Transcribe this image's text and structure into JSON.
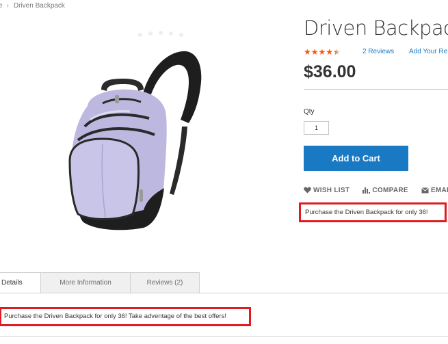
{
  "breadcrumb": {
    "home": "e",
    "current": "Driven Backpack"
  },
  "product": {
    "title": "Driven Backpack",
    "rating": 4.5,
    "rating_max": 5,
    "reviews_link": "2 Reviews",
    "add_review_link": "Add Your Re",
    "price": "$36.00",
    "qty_label": "Qty",
    "qty_value": "1",
    "add_to_cart": "Add to Cart",
    "actions": [
      {
        "label": "WISH LIST",
        "icon": "heart-icon"
      },
      {
        "label": "COMPARE",
        "icon": "compare-icon"
      },
      {
        "label": "EMAI",
        "icon": "envelope-icon"
      }
    ],
    "short_description": "Purchase the Driven Backpack for only 36!"
  },
  "tabs": [
    {
      "label": "Details",
      "active": true
    },
    {
      "label": "More Information",
      "active": false
    },
    {
      "label": "Reviews (2)",
      "active": false
    }
  ],
  "details_text": "Purchase the Driven Backpack for only 36! Take adventage of the best offers!",
  "colors": {
    "accent": "#1979c3",
    "stars": "#ff5501",
    "highlight": "#dd1d21",
    "backpack_body": "#bdb8e0",
    "backpack_dark": "#1e1e1e"
  }
}
